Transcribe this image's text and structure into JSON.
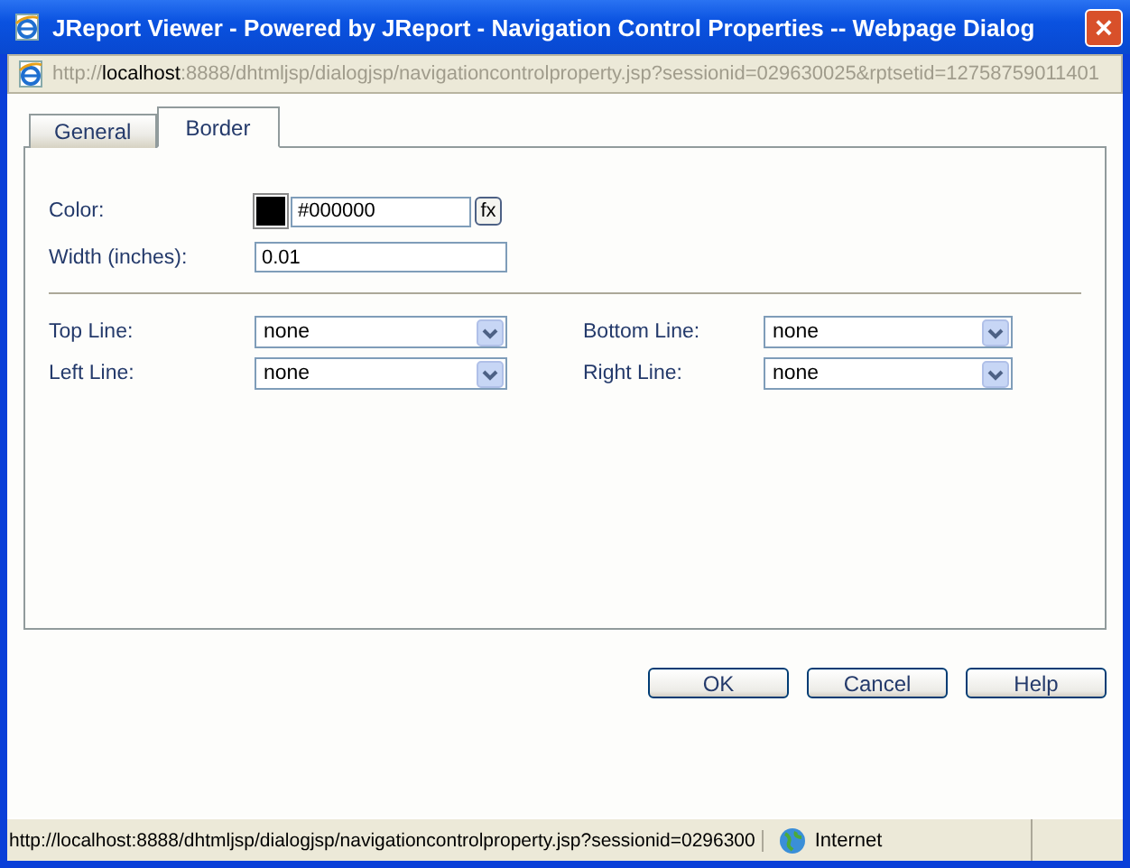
{
  "window": {
    "title": "JReport Viewer - Powered by JReport - Navigation Control Properties -- Webpage Dialog",
    "close": "×"
  },
  "address_bar": {
    "scheme": "http://",
    "host": "localhost",
    "rest": ":8888/dhtmljsp/dialogjsp/navigationcontrolproperty.jsp?sessionid=029630025&rptsetid=12758759011401"
  },
  "tabs": [
    {
      "label": "General",
      "selected": false
    },
    {
      "label": "Border",
      "selected": true
    }
  ],
  "color": {
    "label": "Color:",
    "value": "#000000",
    "swatch": {
      "color": "#000000"
    },
    "fx": "fx"
  },
  "width": {
    "label": "Width (inches):",
    "value": "0.01"
  },
  "line_selects": [
    {
      "label": "Top Line:",
      "value": "none"
    },
    {
      "label": "Bottom Line:",
      "value": "none"
    },
    {
      "label": "Left Line:",
      "value": "none"
    },
    {
      "label": "Right Line:",
      "value": "none"
    }
  ],
  "buttons": [
    "OK",
    "Cancel",
    "Help"
  ],
  "status_bar": {
    "url": "http://localhost:8888/dhtmljsp/dialogjsp/navigationcontrolproperty.jsp?sessionid=0296300",
    "zone": "Internet"
  }
}
